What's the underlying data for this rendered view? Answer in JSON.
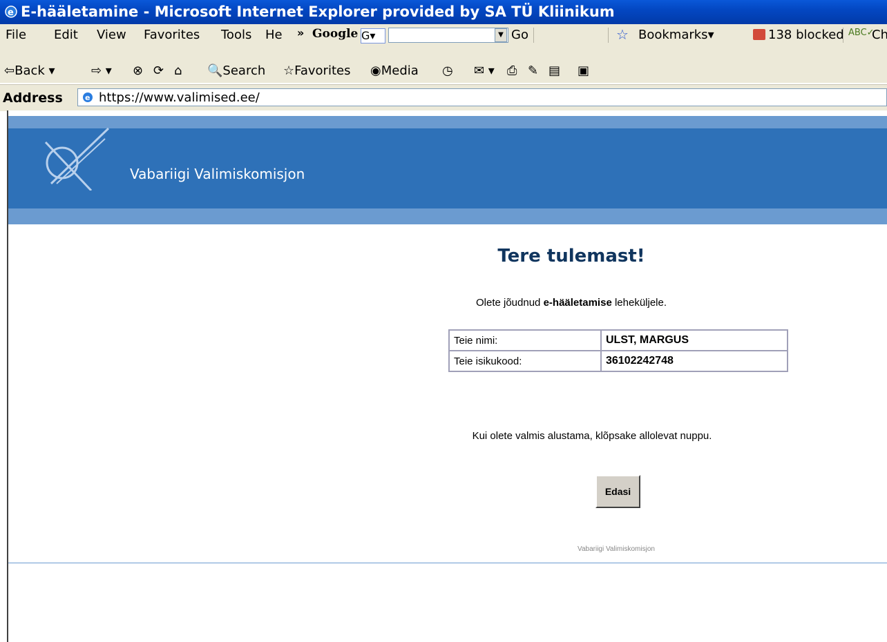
{
  "window": {
    "title": "E-hääletamine - Microsoft Internet Explorer provided by SA TÜ Kliinikum"
  },
  "menu": {
    "items": [
      "File",
      "Edit",
      "View",
      "Favorites",
      "Tools",
      "He"
    ],
    "overflow": "»"
  },
  "google_bar": {
    "logo": "Google",
    "g_button": "G▾",
    "go_label": "Go",
    "bookmarks_label": "Bookmarks▾",
    "blocked_label": "138 blocked",
    "spell_label": "Ch"
  },
  "toolbar": {
    "back_label": "Back",
    "search_label": "Search",
    "favorites_label": "Favorites",
    "media_label": "Media"
  },
  "address": {
    "label": "Address",
    "url": "https://www.valimised.ee/"
  },
  "page": {
    "org_name": "Vabariigi Valimiskomisjon",
    "welcome": "Tere tulemast!",
    "intro_prefix": "Olete jõudnud ",
    "intro_bold": "e-hääletamise",
    "intro_suffix": " leheküljele.",
    "info": [
      {
        "label": "Teie nimi:",
        "value": "ULST, MARGUS"
      },
      {
        "label": "Teie isikukood:",
        "value": "36102242748"
      }
    ],
    "instruction": "Kui olete valmis alustama, klõpsake allolevat nuppu.",
    "next_button": "Edasi",
    "footer": "Vabariigi Valimiskomisjon"
  },
  "colors": {
    "titlebar": "#0347c2",
    "chrome": "#ece9d8",
    "banner": "#2e71b8",
    "band": "#6b9bd0",
    "heading": "#10355e"
  }
}
